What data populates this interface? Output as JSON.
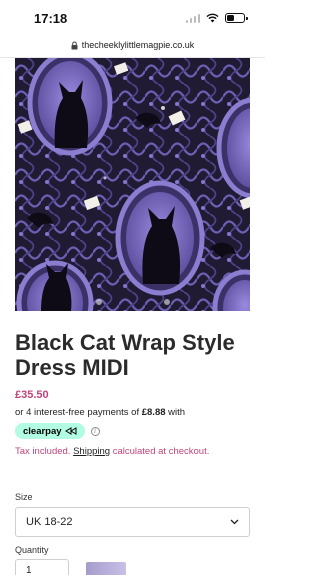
{
  "status_bar": {
    "time": "17:18"
  },
  "browser": {
    "url": "thecheeklylittlemagpie.co.uk"
  },
  "product": {
    "title": "Black Cat Wrap Style Dress MIDI",
    "price": "£35.50",
    "installments_prefix": "or 4 interest-free payments of ",
    "installments_amount": "£8.88",
    "installments_suffix": " with",
    "clearpay_label": "clearpay",
    "tax_prefix": "Tax included. ",
    "tax_link": "Shipping",
    "tax_suffix": " calculated at checkout."
  },
  "options": {
    "size_label": "Size",
    "size_value": "UK 18-22",
    "quantity_label": "Quantity",
    "quantity_value": "1"
  },
  "colors": {
    "accent": "#c0457a",
    "clearpay_mint": "#b2fce4",
    "pattern_purple": "#7b6bc4",
    "pattern_dark": "#1b1726"
  }
}
